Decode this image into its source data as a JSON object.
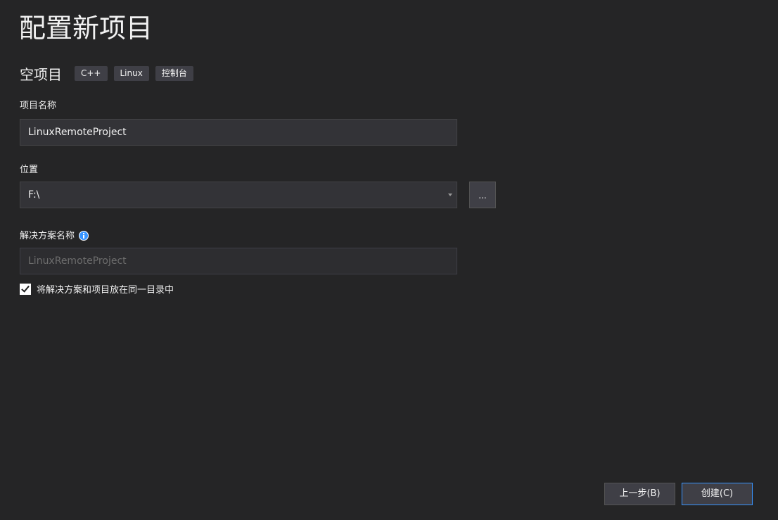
{
  "page": {
    "title": "配置新项目"
  },
  "template": {
    "name": "空项目",
    "tags": [
      "C++",
      "Linux",
      "控制台"
    ]
  },
  "project_name": {
    "label": "项目名称",
    "value": "LinuxRemoteProject"
  },
  "location": {
    "label": "位置",
    "value": "F:\\",
    "browse_label": "..."
  },
  "solution_name": {
    "label": "解决方案名称",
    "placeholder": "LinuxRemoteProject",
    "info_icon": "info-icon"
  },
  "same_directory": {
    "label": "将解决方案和项目放在同一目录中",
    "checked": true
  },
  "footer": {
    "back_label": "上一步(B)",
    "create_label": "创建(C)"
  },
  "colors": {
    "background": "#252526",
    "input_bg": "#333337",
    "accent": "#3794ff"
  }
}
